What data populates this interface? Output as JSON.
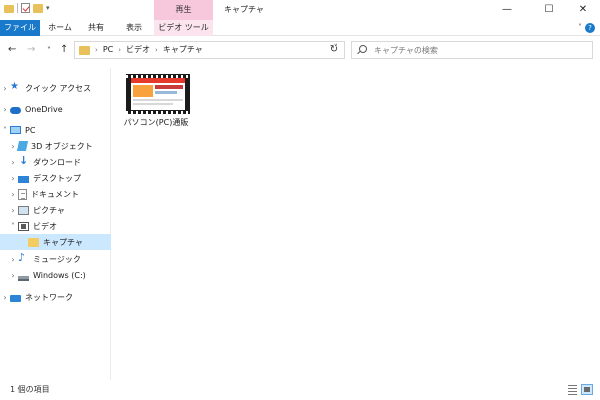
{
  "window": {
    "title": "キャプチャ",
    "context_tab": "再生",
    "minimize": "—",
    "maximize": "☐",
    "close": "✕"
  },
  "ribbon": {
    "tabs": [
      "ファイル",
      "ホーム",
      "共有",
      "表示",
      "ビデオ ツール"
    ],
    "accent": "#1979CA",
    "context_color": "#F7C8DC"
  },
  "nav": {
    "back": "←",
    "forward": "→",
    "recent": "˅",
    "up": "↑",
    "breadcrumbs": [
      "PC",
      "ビデオ",
      "キャプチャ"
    ],
    "refresh": "↻",
    "search_placeholder": "キャプチャの検索"
  },
  "sidebar": {
    "items": [
      {
        "label": "クイック アクセス",
        "icon": "star-icon"
      },
      {
        "label": "OneDrive",
        "icon": "cloud-icon"
      },
      {
        "label": "PC",
        "icon": "pc-icon"
      },
      {
        "label": "3D オブジェクト",
        "icon": "3d-objects-icon"
      },
      {
        "label": "ダウンロード",
        "icon": "download-icon"
      },
      {
        "label": "デスクトップ",
        "icon": "desktop-icon"
      },
      {
        "label": "ドキュメント",
        "icon": "document-icon"
      },
      {
        "label": "ピクチャ",
        "icon": "pictures-icon"
      },
      {
        "label": "ビデオ",
        "icon": "video-icon"
      },
      {
        "label": "キャプチャ",
        "icon": "folder-icon"
      },
      {
        "label": "ミュージック",
        "icon": "music-icon"
      },
      {
        "label": "Windows (C:)",
        "icon": "drive-icon"
      },
      {
        "label": "ネットワーク",
        "icon": "network-icon"
      }
    ],
    "selected_color": "#CCE8FF"
  },
  "content": {
    "files": [
      {
        "name": "パソコン(PC)通販",
        "type": "video-file"
      }
    ]
  },
  "status": {
    "item_count": "1 個の項目"
  }
}
